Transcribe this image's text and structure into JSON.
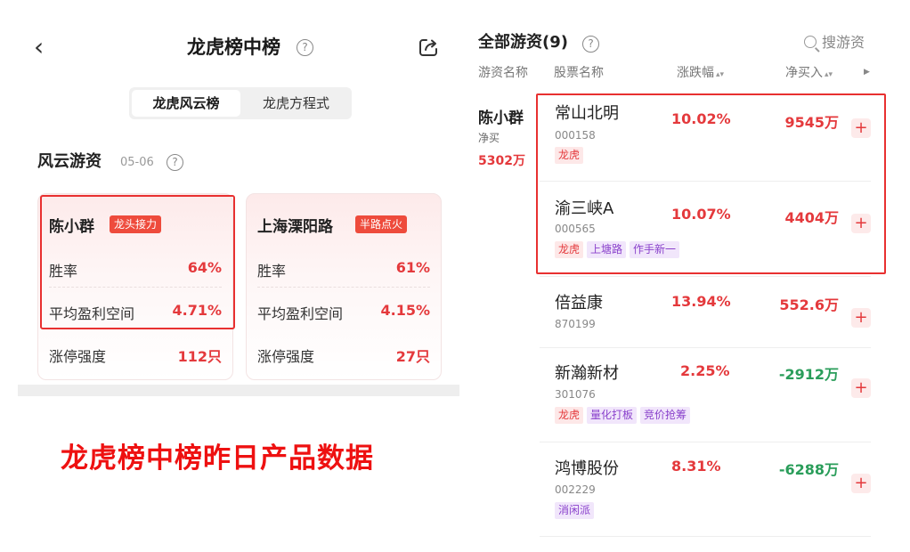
{
  "left": {
    "nav": {
      "title": "龙虎榜中榜"
    },
    "segments": [
      "龙虎风云榜",
      "龙虎方程式"
    ],
    "section": {
      "title": "风云游资",
      "date": "05-06"
    },
    "cards": [
      {
        "name": "陈小群",
        "tag": "龙头接力",
        "rows": [
          {
            "label": "胜率",
            "value": "64%"
          },
          {
            "label": "平均盈利空间",
            "value": "4.71%"
          },
          {
            "label": "涨停强度",
            "value": "112只"
          }
        ]
      },
      {
        "name": "上海溧阳路",
        "tag": "半路点火",
        "rows": [
          {
            "label": "胜率",
            "value": "61%"
          },
          {
            "label": "平均盈利空间",
            "value": "4.15%"
          },
          {
            "label": "涨停强度",
            "value": "27只"
          }
        ]
      }
    ],
    "caption": "龙虎榜中榜昨日产品数据"
  },
  "right": {
    "title": "全部游资(9)",
    "search_label": "搜游资",
    "headers": {
      "investor": "游资名称",
      "stock": "股票名称",
      "change": "涨跌幅",
      "net": "净买入"
    },
    "investor": {
      "name": "陈小群",
      "sub": "净买",
      "amount": "5302万"
    },
    "stocks": [
      {
        "name": "常山北明",
        "code": "000158",
        "change": "10.02%",
        "net": "9545万",
        "net_sign": "pos",
        "tags": [
          {
            "text": "龙虎",
            "style": "red"
          }
        ]
      },
      {
        "name": "渝三峡A",
        "code": "000565",
        "change": "10.07%",
        "net": "4404万",
        "net_sign": "pos",
        "tags": [
          {
            "text": "龙虎",
            "style": "red"
          },
          {
            "text": "上塘路",
            "style": "purple"
          },
          {
            "text": "作手新一",
            "style": "purple"
          }
        ]
      },
      {
        "name": "倍益康",
        "code": "870199",
        "change": "13.94%",
        "net": "552.6万",
        "net_sign": "pos",
        "tags": []
      },
      {
        "name": "新瀚新材",
        "code": "301076",
        "change": "2.25%",
        "net": "-2912万",
        "net_sign": "neg",
        "tags": [
          {
            "text": "龙虎",
            "style": "red"
          },
          {
            "text": "量化打板",
            "style": "purple"
          },
          {
            "text": "竞价抢筹",
            "style": "purple"
          }
        ]
      },
      {
        "name": "鸿博股份",
        "code": "002229",
        "change": "8.31%",
        "net": "-6288万",
        "net_sign": "neg",
        "tags": [
          {
            "text": "消闲派",
            "style": "purple"
          }
        ]
      }
    ]
  },
  "colors": {
    "accent_red": "#e4393c",
    "highlight_border": "#e83030",
    "negative_green": "#2a9d5a",
    "tag_purple": "#8a42cc"
  }
}
